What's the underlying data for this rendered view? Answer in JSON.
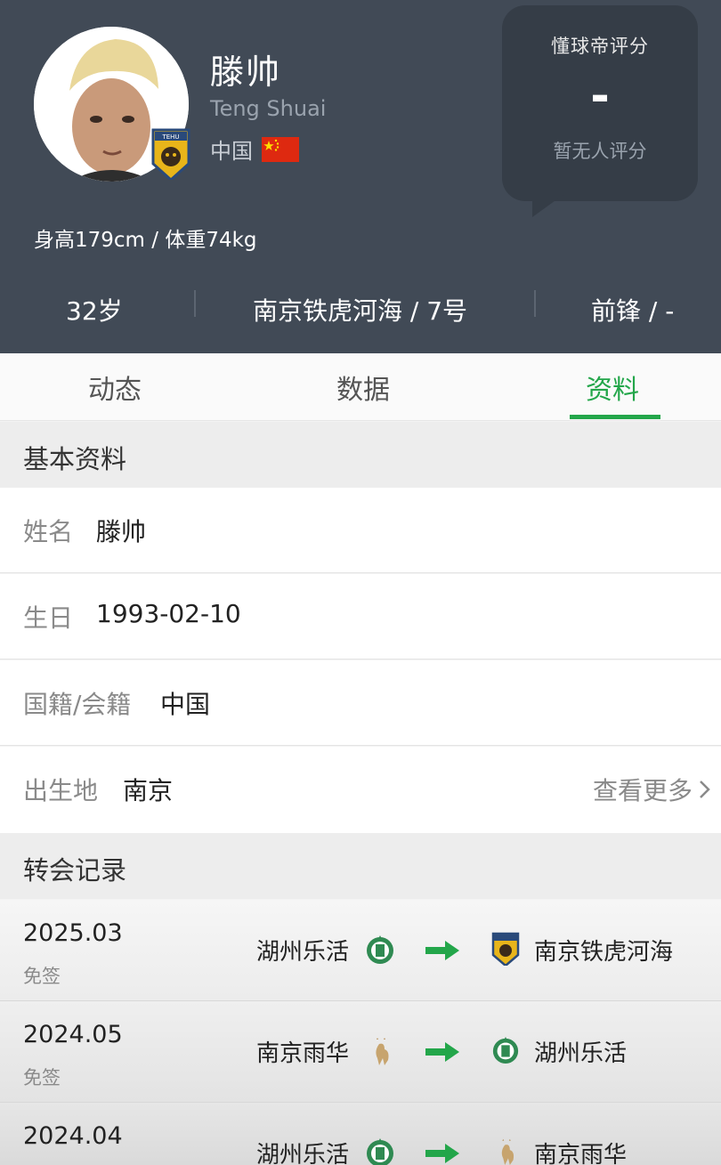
{
  "header": {
    "player_name": "滕帅",
    "player_name_en": "Teng Shuai",
    "nationality": "中国",
    "rating_title": "懂球帝评分",
    "rating_value": "-",
    "rating_sub": "暂无人评分",
    "body_stats": "身高179cm / 体重74kg",
    "age": "32岁",
    "club_number": "南京铁虎河海 / 7号",
    "position": "前锋 / -"
  },
  "tabs": [
    {
      "label": "动态",
      "active": false
    },
    {
      "label": "数据",
      "active": false
    },
    {
      "label": "资料",
      "active": true
    }
  ],
  "colors": {
    "accent": "#23a64a",
    "header_bg": "#414a56"
  },
  "basic_info": {
    "title": "基本资料",
    "rows": [
      {
        "label": "姓名",
        "value": "滕帅"
      },
      {
        "label": "生日",
        "value": "1993-02-10"
      },
      {
        "label": "国籍/会籍",
        "value": "中国"
      },
      {
        "label": "出生地",
        "value": "南京"
      }
    ],
    "more_label": "查看更多"
  },
  "transfers": {
    "title": "转会记录",
    "items": [
      {
        "date": "2025.03",
        "type": "免签",
        "from": "湖州乐活",
        "to": "南京铁虎河海"
      },
      {
        "date": "2024.05",
        "type": "免签",
        "from": "南京雨华",
        "to": "湖州乐活"
      },
      {
        "date": "2024.04",
        "type": "",
        "from": "湖州乐活",
        "to": "南京雨华"
      }
    ]
  }
}
